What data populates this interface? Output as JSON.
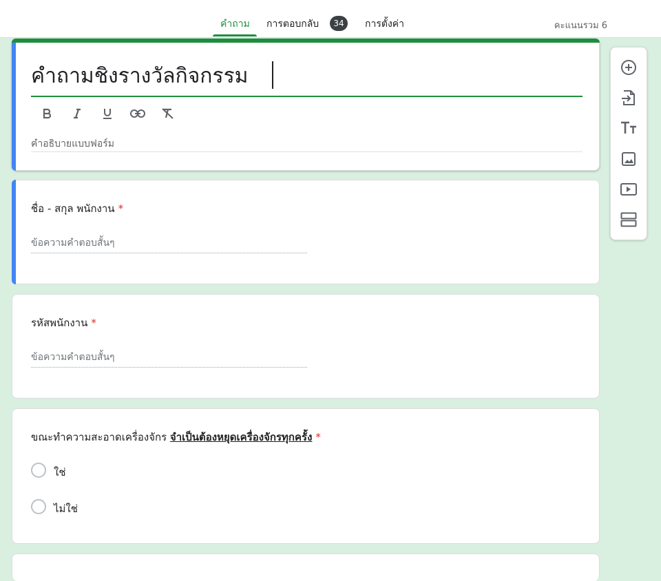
{
  "header": {
    "tabs": [
      {
        "label": "คำถาม",
        "active": true
      },
      {
        "label": "การตอบกลับ",
        "badge": "34"
      },
      {
        "label": "การตั้งค่า"
      }
    ],
    "score": "คะแนนรวม 6"
  },
  "form": {
    "title": "คำถามชิงรางวัลกิจกรรม",
    "description_placeholder": "คำอธิบายแบบฟอร์ม",
    "format_tools": [
      "bold-icon",
      "italic-icon",
      "underline-icon",
      "link-icon",
      "clear-format-icon"
    ]
  },
  "questions": [
    {
      "title": "ชื่อ - สกุล พนักงาน",
      "required_mark": "*",
      "answer_placeholder": "ข้อความคำตอบสั้นๆ"
    },
    {
      "title": "รหัสพนักงาน",
      "required_mark": "*",
      "answer_placeholder": "ข้อความคำตอบสั้นๆ"
    },
    {
      "title_prefix": "ขณะทำความสะอาดเครื่องจักร ",
      "title_emphasis": "จำเป็นต้องหยุดเครื่องจักรทุกครั้ง",
      "required_mark": "*",
      "options": [
        "ใช่",
        "ไม่ใช่"
      ]
    }
  ],
  "side_toolbar": [
    "add-question-icon",
    "import-questions-icon",
    "add-title-icon",
    "add-image-icon",
    "add-video-icon",
    "add-section-icon"
  ],
  "colors": {
    "accent": "#1e8e3e",
    "focus": "#4285f4",
    "background": "#d9efe0",
    "required": "#d93025"
  }
}
